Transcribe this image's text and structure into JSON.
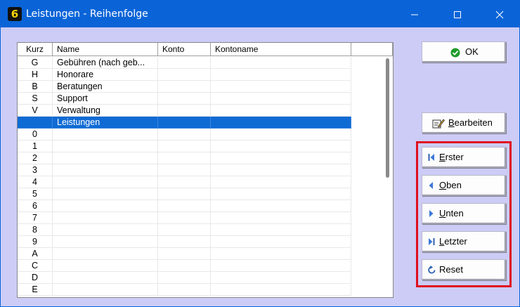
{
  "window": {
    "title": "Leistungen - Reihenfolge",
    "app_icon_glyph": "6"
  },
  "titlebar_controls": {
    "minimize": "—",
    "maximize": "☐",
    "close": "✕"
  },
  "list": {
    "headers": [
      "Kurz",
      "Name",
      "Konto",
      "Kontoname"
    ],
    "rows": [
      {
        "kurz": "G",
        "name": "Gebühren (nach geb...",
        "konto": "",
        "kontoname": ""
      },
      {
        "kurz": "H",
        "name": "Honorare",
        "konto": "",
        "kontoname": ""
      },
      {
        "kurz": "B",
        "name": "Beratungen",
        "konto": "",
        "kontoname": ""
      },
      {
        "kurz": "S",
        "name": "Support",
        "konto": "",
        "kontoname": ""
      },
      {
        "kurz": "V",
        "name": "Verwaltung",
        "konto": "",
        "kontoname": ""
      },
      {
        "kurz": "",
        "name": "Leistungen",
        "konto": "",
        "kontoname": "",
        "selected": true
      },
      {
        "kurz": "0",
        "name": "",
        "konto": "",
        "kontoname": ""
      },
      {
        "kurz": "1",
        "name": "",
        "konto": "",
        "kontoname": ""
      },
      {
        "kurz": "2",
        "name": "",
        "konto": "",
        "kontoname": ""
      },
      {
        "kurz": "3",
        "name": "",
        "konto": "",
        "kontoname": ""
      },
      {
        "kurz": "4",
        "name": "",
        "konto": "",
        "kontoname": ""
      },
      {
        "kurz": "5",
        "name": "",
        "konto": "",
        "kontoname": ""
      },
      {
        "kurz": "6",
        "name": "",
        "konto": "",
        "kontoname": ""
      },
      {
        "kurz": "7",
        "name": "",
        "konto": "",
        "kontoname": ""
      },
      {
        "kurz": "8",
        "name": "",
        "konto": "",
        "kontoname": ""
      },
      {
        "kurz": "9",
        "name": "",
        "konto": "",
        "kontoname": ""
      },
      {
        "kurz": "A",
        "name": "",
        "konto": "",
        "kontoname": ""
      },
      {
        "kurz": "C",
        "name": "",
        "konto": "",
        "kontoname": ""
      },
      {
        "kurz": "D",
        "name": "",
        "konto": "",
        "kontoname": ""
      },
      {
        "kurz": "E",
        "name": "",
        "konto": "",
        "kontoname": ""
      }
    ]
  },
  "buttons": {
    "ok": {
      "label": "OK",
      "icon": "check-icon"
    },
    "bearbeiten": {
      "accel": "B",
      "rest": "earbeiten",
      "icon": "edit-icon"
    },
    "erster": {
      "accel": "E",
      "rest": "rster",
      "icon": "first-icon"
    },
    "oben": {
      "accel": "O",
      "rest": "ben",
      "icon": "up-icon"
    },
    "unten": {
      "accel": "U",
      "rest": "nten",
      "icon": "down-icon"
    },
    "letzter": {
      "accel": "L",
      "rest": "etzter",
      "icon": "last-icon"
    },
    "reset": {
      "label": "Reset",
      "icon": "reset-icon"
    }
  },
  "colors": {
    "titlebar": "#0a64d8",
    "background": "#ccccf6",
    "selection": "#0f6bd4",
    "highlight": "#e0101e"
  }
}
